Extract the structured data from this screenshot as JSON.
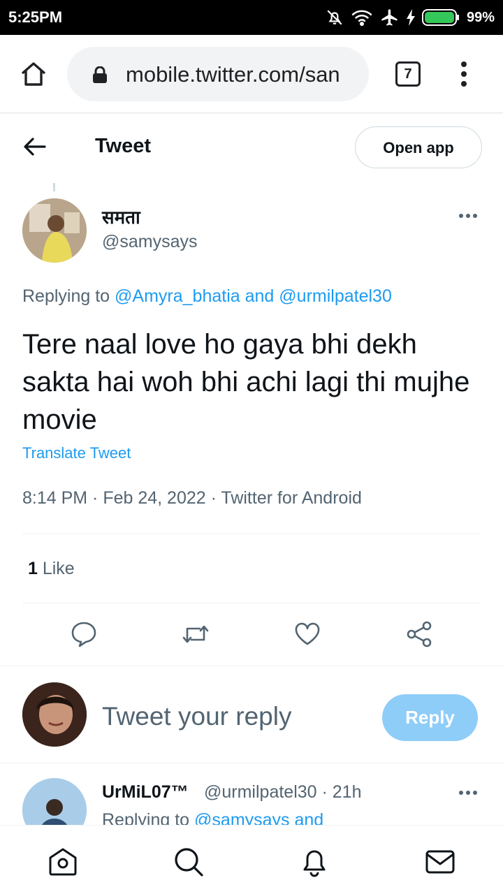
{
  "status_bar": {
    "time": "5:25PM",
    "battery": "99%",
    "icons": [
      "bell-off-icon",
      "wifi-icon",
      "airplane-icon",
      "charging-icon",
      "battery-icon"
    ]
  },
  "browser": {
    "url": "mobile.twitter.com/san",
    "tab_count": "7",
    "icons": [
      "home-icon",
      "lock-icon",
      "tabs-icon",
      "more-vert-icon"
    ]
  },
  "header": {
    "title": "Tweet",
    "open_app_label": "Open app"
  },
  "tweet": {
    "display_name": "समता",
    "handle": "@samysays",
    "replying_prefix": "Replying to ",
    "replying_user1": "@Amyra_bhatia",
    "replying_and": " and ",
    "replying_user2": "@urmilpatel30",
    "text": "Tere naal love ho gaya bhi dekh sakta hai woh bhi achi lagi thi mujhe movie",
    "translate_label": "Translate Tweet",
    "meta": "8:14 PM · Feb 24, 2022 · Twitter for Android",
    "like_count": "1",
    "like_label": " Like"
  },
  "compose": {
    "placeholder": "Tweet your reply",
    "reply_label": "Reply"
  },
  "reply_tweet": {
    "display_name": "UrMiL07™",
    "handle_time": "@urmilpatel30 · 21h",
    "replying_prefix": "Replying to ",
    "replying_user": "@samysays and"
  },
  "colors": {
    "accent": "#1d9bf0",
    "reply_button_disabled": "#8ecdf8",
    "secondary_text": "#536471"
  }
}
